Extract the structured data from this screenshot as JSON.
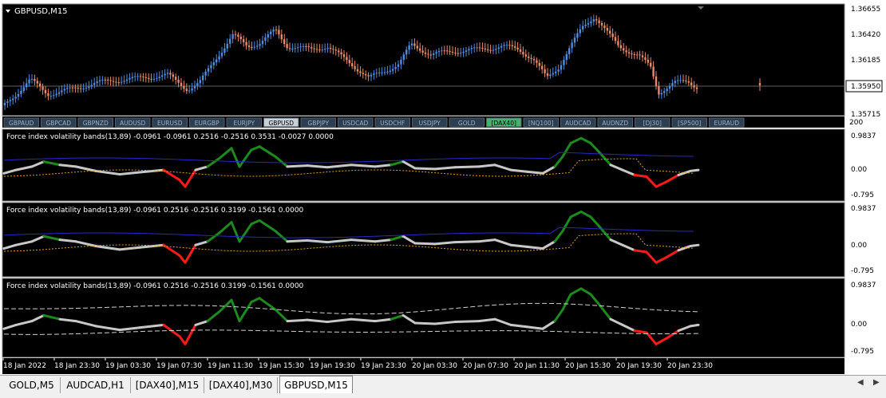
{
  "main_chart": {
    "symbol_title": "GBPUSD,M15",
    "price_labels": [
      "1.36655",
      "1.36420",
      "1.36185",
      "1.35950",
      "1.35715"
    ],
    "current_price": "1.35950",
    "colors": {
      "bull": "#4f8bdf",
      "bear": "#e88a6a",
      "background": "#000000",
      "axis_text": "#000000"
    }
  },
  "symbol_tabs": {
    "items": [
      "GBPAUD",
      "GBPCAD",
      "GBPNZD",
      "AUDUSD",
      "EURUSD",
      "EURGBP",
      "EURJPY",
      "GBPUSD",
      "GBPJPY",
      "USDCAD",
      "USDCHF",
      "USDJPY",
      "GOLD",
      "[DAX40]",
      "[NQ100]",
      "AUDCAD",
      "AUDNZD",
      "[DJ30]",
      "[SP500]",
      "EURAUD"
    ],
    "active_index": 7,
    "highlight_index": 13,
    "scale_value": "200"
  },
  "indicator_panes": [
    {
      "title": "Force index volatility bands(13,89) -0.0961 -0.0961 0.2516 -0.2516 0.3531 -0.0027 0.0000",
      "levels": [
        "0.9837",
        "0.00",
        "-0.795"
      ]
    },
    {
      "title": "Force index volatility bands(13,89) -0.0961 0.2516 -0.2516 0.3199 -0.1561 0.0000",
      "levels": [
        "0.9837",
        "0.00",
        "-0.795"
      ]
    },
    {
      "title": "Force index volatility bands(13,89) -0.0961 0.2516 -0.2516 0.3199 -0.1561 0.0000",
      "levels": [
        "0.9837",
        "0.00",
        "-0.795"
      ]
    }
  ],
  "time_axis": [
    "18 Jan 2022",
    "18 Jan 23:30",
    "19 Jan 03:30",
    "19 Jan 07:30",
    "19 Jan 11:30",
    "19 Jan 15:30",
    "19 Jan 19:30",
    "19 Jan 23:30",
    "20 Jan 03:30",
    "20 Jan 07:30",
    "20 Jan 11:30",
    "20 Jan 15:30",
    "20 Jan 19:30",
    "20 Jan 23:30"
  ],
  "window_tabs": {
    "items": [
      "GOLD,M5",
      "AUDCAD,H1",
      "[DAX40],M15",
      "[DAX40],M30",
      "GBPUSD,M15"
    ],
    "active_index": 4
  },
  "icons": {
    "scroll_left": "triangle-left-icon",
    "scroll_right": "triangle-right-icon",
    "dropdown": "triangle-down-icon"
  }
}
